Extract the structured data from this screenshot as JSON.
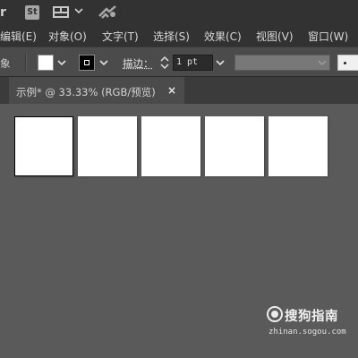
{
  "app_bar": {
    "app_glyph": "r",
    "stock_label": "St",
    "icons": [
      "layout-grid-icon",
      "chevron-down-icon",
      "gpu-performance-icon"
    ]
  },
  "menu": {
    "items": [
      {
        "label": "编辑(E)"
      },
      {
        "label": "对象(O)"
      },
      {
        "label": "文字(T)"
      },
      {
        "label": "选择(S)"
      },
      {
        "label": "效果(C)"
      },
      {
        "label": "视图(V)"
      },
      {
        "label": "窗口(W)"
      }
    ]
  },
  "control_bar": {
    "selection_label": "象",
    "fill_color": "#ffffff",
    "stroke_color": "#000000",
    "stroke_label": "描边：",
    "stroke_weight": "1 pt"
  },
  "document": {
    "tab_title": "示例* @ 33.33% (RGB/预览)",
    "close_glyph": "×",
    "artboards": [
      {
        "name": "artboard-1",
        "active": true
      },
      {
        "name": "artboard-2",
        "active": false
      },
      {
        "name": "artboard-3",
        "active": false
      },
      {
        "name": "artboard-4",
        "active": false
      },
      {
        "name": "artboard-5",
        "active": false
      }
    ]
  },
  "watermark": {
    "brand": "搜狗指南",
    "url": "zhinan.sogou.com"
  },
  "colors": {
    "app_bar_bg": "#323232",
    "control_bar_bg": "#4b4b4b",
    "canvas_bg": "#5a5a5a",
    "artboard_bg": "#ffffff"
  }
}
